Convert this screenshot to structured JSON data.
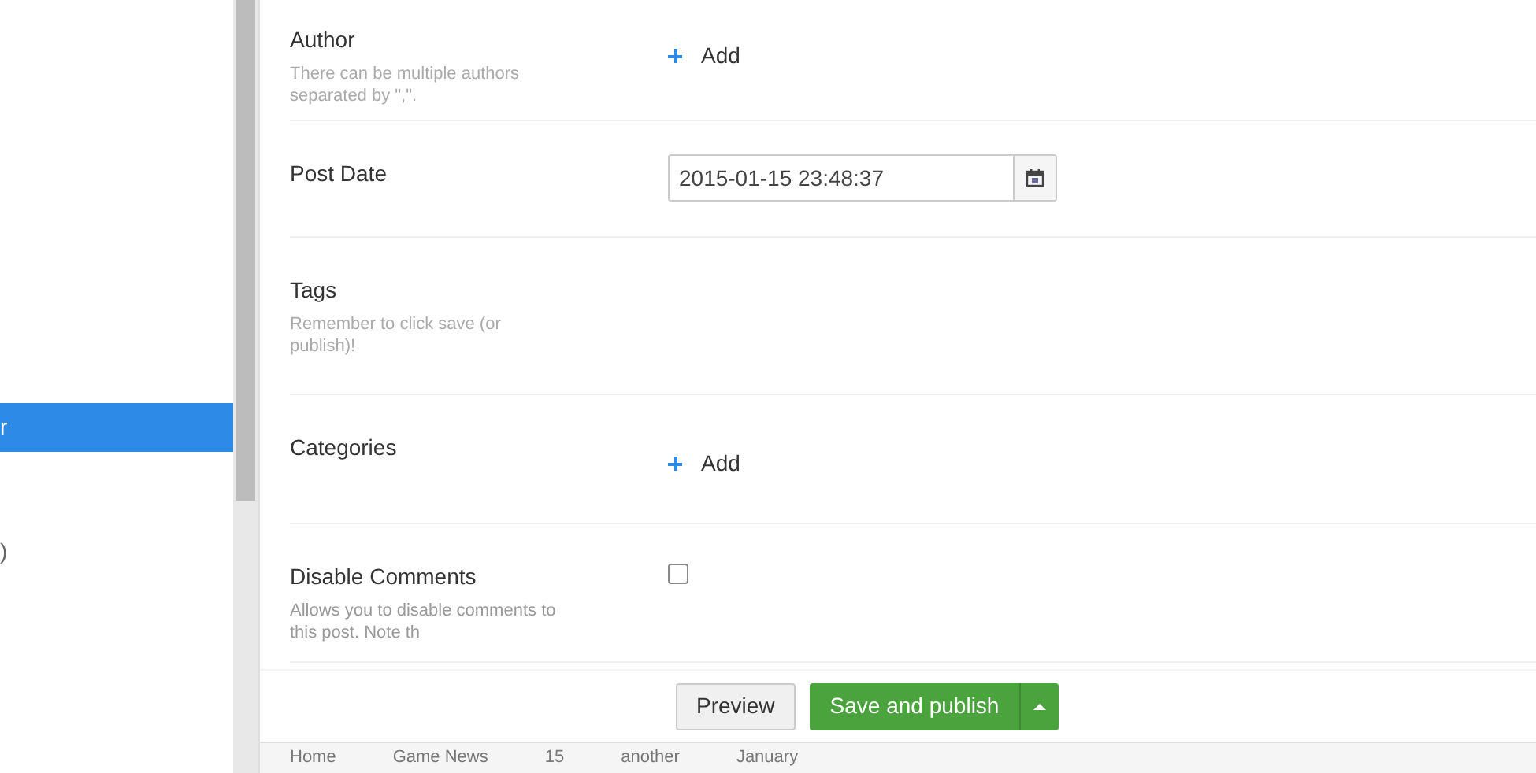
{
  "sidebar": {
    "items": [
      {
        "label": "r",
        "selected": true
      },
      {
        "label": ")",
        "selected": false
      }
    ]
  },
  "fields": [
    {
      "kind": "add",
      "label": "Author",
      "help": "There can be multiple authors separated by \",\".",
      "action": "Add"
    },
    {
      "kind": "date",
      "label": "Post Date",
      "value": "2015-01-15 23:48:37"
    },
    {
      "kind": "empty",
      "label": "Tags",
      "help": "Remember to click save (or publish)!"
    },
    {
      "kind": "add",
      "label": "Categories",
      "action": "Add"
    },
    {
      "kind": "checkbox",
      "label": "Disable Comments",
      "help": "Allows you to disable comments to this post. Note th",
      "checked": false
    }
  ],
  "actions": {
    "preview": "Preview",
    "publish": "Save and publish"
  },
  "breadcrumbs": [
    "Home",
    "Game News",
    "15",
    "another",
    "January"
  ]
}
